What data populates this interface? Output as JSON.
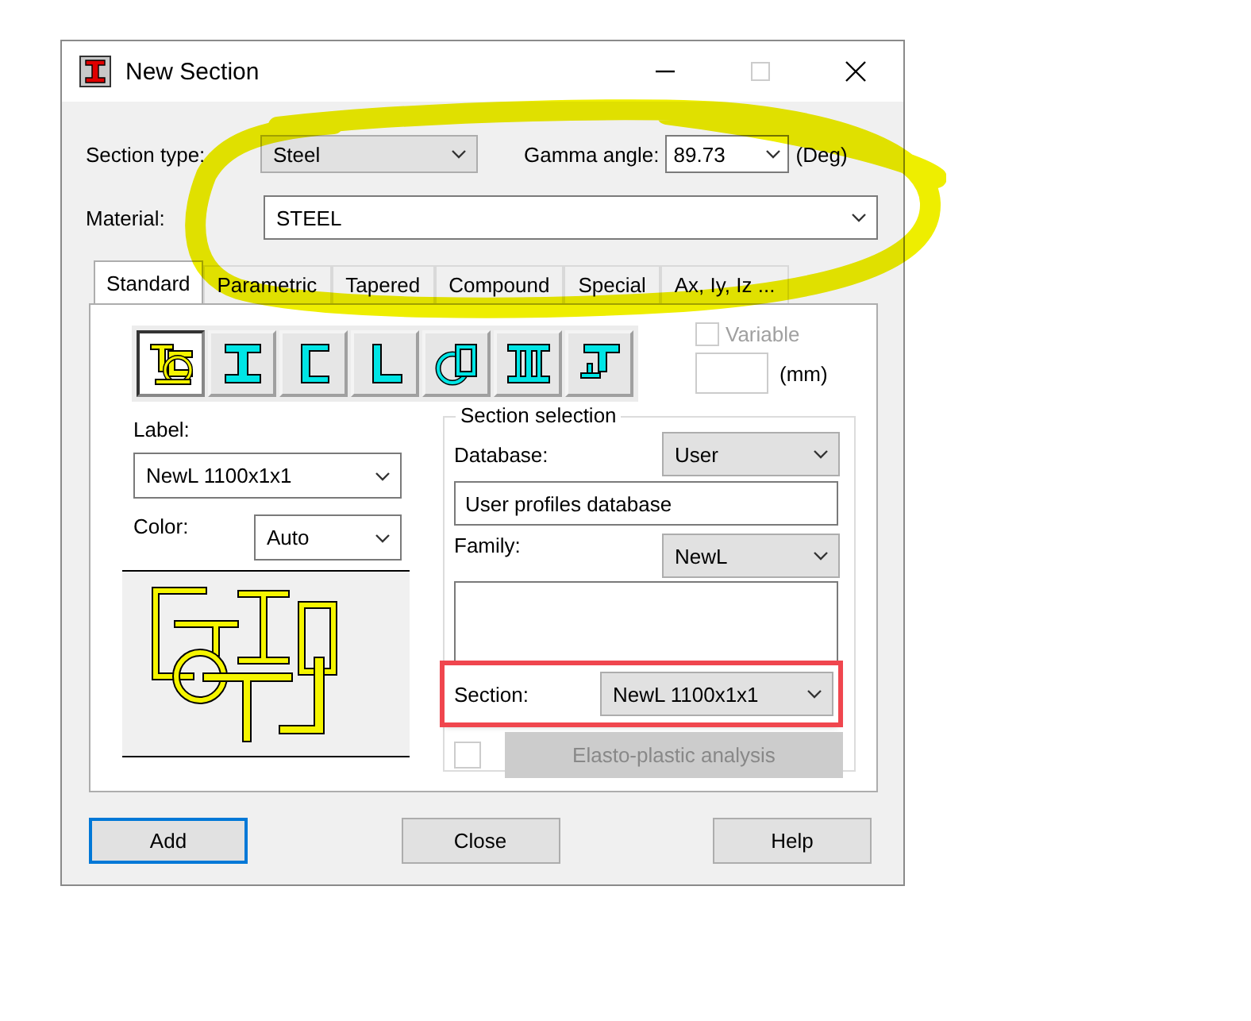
{
  "window": {
    "title": "New Section"
  },
  "section_type": {
    "label": "Section type:",
    "value": "Steel"
  },
  "gamma_angle": {
    "label": "Gamma angle:",
    "value": "89.73",
    "unit": "(Deg)"
  },
  "material": {
    "label": "Material:",
    "value": "STEEL"
  },
  "tabs": [
    {
      "label": "Standard",
      "selected": true
    },
    {
      "label": "Parametric",
      "selected": false
    },
    {
      "label": "Tapered",
      "selected": false
    },
    {
      "label": "Compound",
      "selected": false
    },
    {
      "label": "Special",
      "selected": false
    },
    {
      "label": "Ax, Iy, Iz ...",
      "selected": false
    }
  ],
  "shape_buttons": [
    {
      "kind": "all",
      "selected": true
    },
    {
      "kind": "i-beam",
      "selected": false
    },
    {
      "kind": "channel",
      "selected": false
    },
    {
      "kind": "angle",
      "selected": false
    },
    {
      "kind": "tube",
      "selected": false
    },
    {
      "kind": "double-i",
      "selected": false
    },
    {
      "kind": "tee",
      "selected": false
    }
  ],
  "variable": {
    "label": "Variable",
    "checked": false,
    "disabled": true
  },
  "size_unit": "(mm)",
  "label_field": {
    "label": "Label:",
    "value": "NewL 1100x1x1"
  },
  "color_field": {
    "label": "Color:",
    "value": "Auto"
  },
  "section_selection": {
    "title": "Section selection",
    "database": {
      "label": "Database:",
      "value": "User"
    },
    "database_name": "User profiles database",
    "family": {
      "label": "Family:",
      "value": "NewL"
    },
    "section": {
      "label": "Section:",
      "value": "NewL 1100x1x1",
      "highlighted": true
    }
  },
  "elasto_plastic": {
    "label": "Elasto-plastic analysis",
    "checked": false,
    "disabled": true
  },
  "buttons": [
    {
      "label": "Add",
      "focused": true
    },
    {
      "label": "Close",
      "focused": false
    },
    {
      "label": "Help",
      "focused": false
    }
  ]
}
